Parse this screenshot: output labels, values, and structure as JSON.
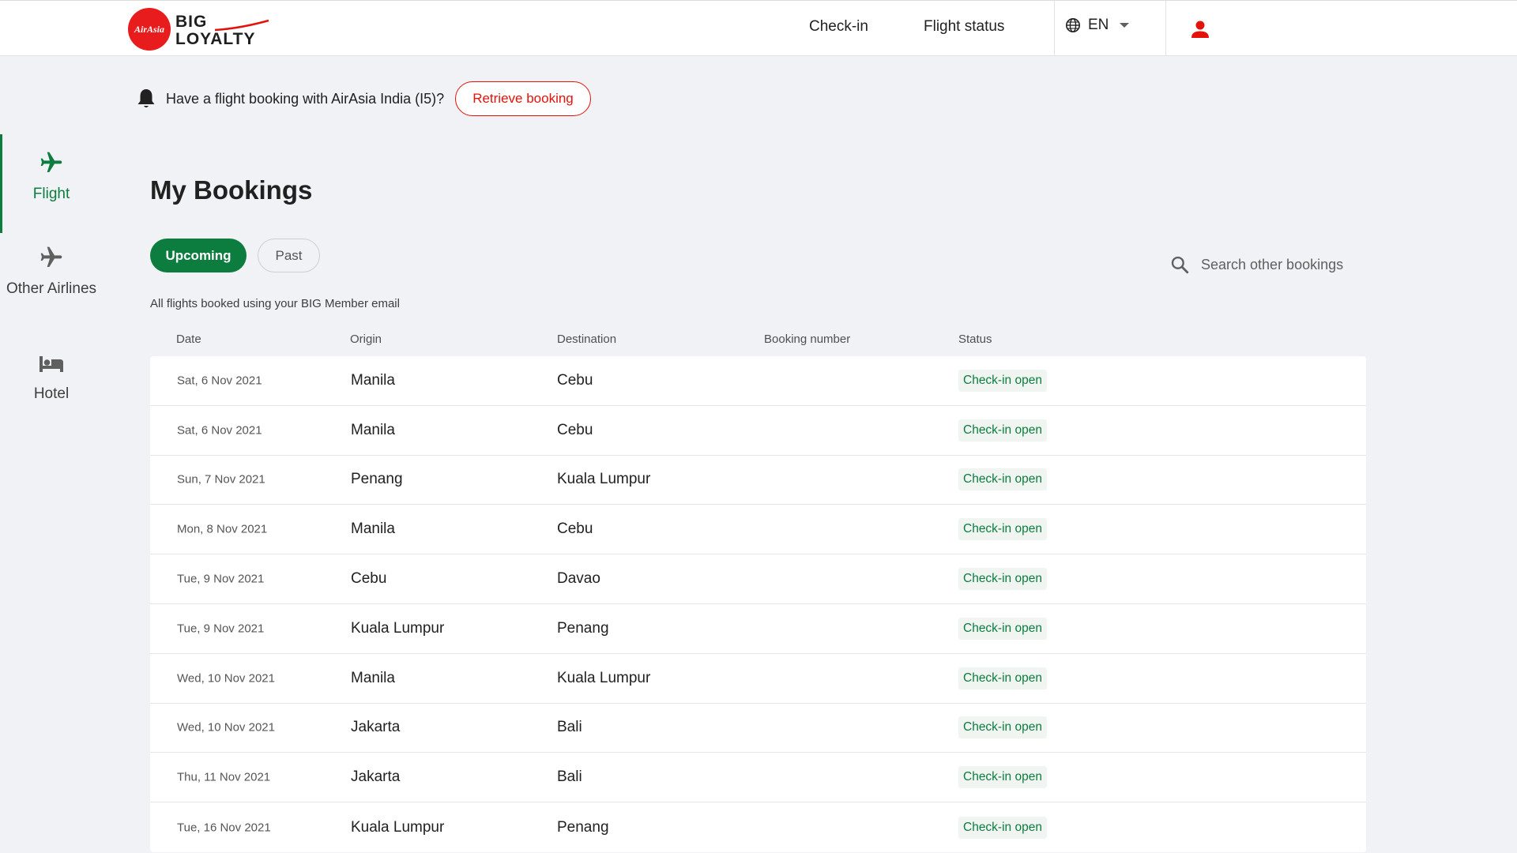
{
  "header": {
    "logo_mark": "AirAsia",
    "logo_line1": "BIG",
    "logo_line2": "LOYALTY",
    "nav": {
      "checkin": "Check-in",
      "flight_status": "Flight status"
    },
    "language": "EN",
    "brand_color": "#e3120b"
  },
  "banner": {
    "text": "Have a flight booking with AirAsia India (I5)?",
    "button": "Retrieve booking"
  },
  "sidebar": {
    "items": [
      {
        "label": "Flight",
        "icon": "airplane-icon",
        "active": true
      },
      {
        "label": "Other Airlines",
        "icon": "airplane-icon",
        "active": false
      },
      {
        "label": "Hotel",
        "icon": "bed-icon",
        "active": false
      }
    ],
    "accent_color": "#0c7d3e"
  },
  "main": {
    "title": "My Bookings",
    "tabs": {
      "upcoming": "Upcoming",
      "past": "Past",
      "selected": "Upcoming"
    },
    "search_placeholder": "Search other bookings",
    "note": "All flights booked using your BIG Member email",
    "columns": {
      "date": "Date",
      "origin": "Origin",
      "destination": "Destination",
      "booking_number": "Booking number",
      "status": "Status"
    },
    "rows": [
      {
        "date": "Sat, 6 Nov 2021",
        "origin": "Manila",
        "destination": "Cebu",
        "booking_number": "",
        "status": "Check-in open"
      },
      {
        "date": "Sat, 6 Nov 2021",
        "origin": "Manila",
        "destination": "Cebu",
        "booking_number": "",
        "status": "Check-in open"
      },
      {
        "date": "Sun, 7 Nov 2021",
        "origin": "Penang",
        "destination": "Kuala Lumpur",
        "booking_number": "",
        "status": "Check-in open"
      },
      {
        "date": "Mon, 8 Nov 2021",
        "origin": "Manila",
        "destination": "Cebu",
        "booking_number": "",
        "status": "Check-in open"
      },
      {
        "date": "Tue, 9 Nov 2021",
        "origin": "Cebu",
        "destination": "Davao",
        "booking_number": "",
        "status": "Check-in open"
      },
      {
        "date": "Tue, 9 Nov 2021",
        "origin": "Kuala Lumpur",
        "destination": "Penang",
        "booking_number": "",
        "status": "Check-in open"
      },
      {
        "date": "Wed, 10 Nov 2021",
        "origin": "Manila",
        "destination": "Kuala Lumpur",
        "booking_number": "",
        "status": "Check-in open"
      },
      {
        "date": "Wed, 10 Nov 2021",
        "origin": "Jakarta",
        "destination": "Bali",
        "booking_number": "",
        "status": "Check-in open"
      },
      {
        "date": "Thu, 11 Nov 2021",
        "origin": "Jakarta",
        "destination": "Bali",
        "booking_number": "",
        "status": "Check-in open"
      },
      {
        "date": "Tue, 16 Nov 2021",
        "origin": "Kuala Lumpur",
        "destination": "Penang",
        "booking_number": "",
        "status": "Check-in open"
      }
    ]
  }
}
